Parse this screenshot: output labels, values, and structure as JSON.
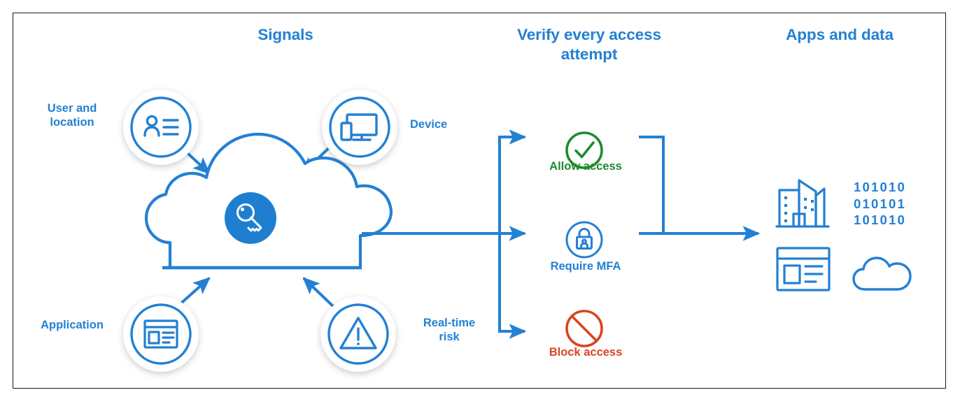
{
  "diagram": {
    "title": "Zero Trust verify every access attempt",
    "colors": {
      "brand_blue": "#2380d4",
      "allow_green": "#1e8b2e",
      "block_red": "#d9451f",
      "border": "#1a1a1a",
      "background": "#ffffff"
    }
  },
  "headers": {
    "signals": "Signals",
    "verify": "Verify every access attempt",
    "verify_line1": "Verify every access",
    "verify_line2": "attempt",
    "apps": "Apps and data"
  },
  "signals": [
    {
      "id": "user-and-location",
      "label": "User and location",
      "label_line1": "User and",
      "label_line2": "location",
      "icon": "contact-card-icon",
      "position": "top-left"
    },
    {
      "id": "device",
      "label": "Device",
      "label_line1": "Device",
      "label_line2": "",
      "icon": "devices-icon",
      "position": "top-right"
    },
    {
      "id": "application",
      "label": "Application",
      "label_line1": "Application",
      "label_line2": "",
      "icon": "app-window-icon",
      "position": "bottom-left"
    },
    {
      "id": "real-time-risk",
      "label": "Real-time risk",
      "label_line1": "Real-time",
      "label_line2": "risk",
      "icon": "warning-triangle-icon",
      "position": "bottom-right"
    }
  ],
  "policy_engine": {
    "shape": "cloud",
    "icon": "key-icon",
    "icon_background": "#1f7ed0"
  },
  "decisions": [
    {
      "id": "allow-access",
      "label": "Allow access",
      "icon": "check-circle-icon",
      "color": "#1e8b2e"
    },
    {
      "id": "require-mfa",
      "label": "Require MFA",
      "icon": "lock-person-icon",
      "color": "#2380d4"
    },
    {
      "id": "block-access",
      "label": "Block access",
      "icon": "prohibited-icon",
      "color": "#d9451f"
    }
  ],
  "apps_and_data": {
    "icons": [
      {
        "id": "buildings",
        "icon": "buildings-icon"
      },
      {
        "id": "binary-data",
        "icon": "binary-data-icon"
      },
      {
        "id": "app-window",
        "icon": "app-window-icon"
      },
      {
        "id": "cloud",
        "icon": "cloud-icon"
      }
    ],
    "binary_rows": [
      "101010",
      "010101",
      "101010"
    ]
  }
}
